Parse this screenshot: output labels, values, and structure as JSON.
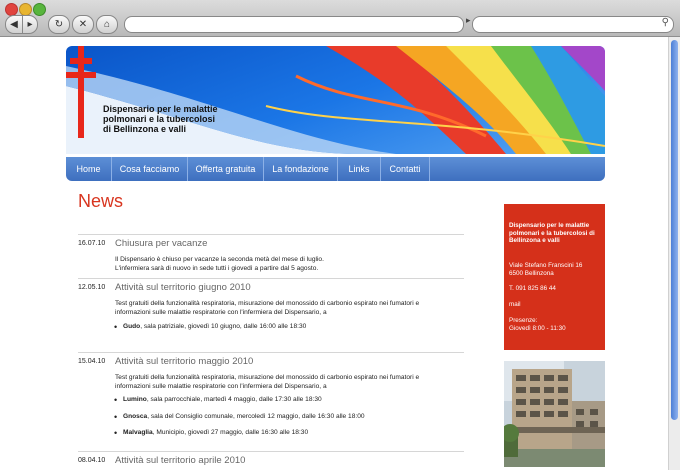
{
  "site": {
    "title": "Dispensario per le malattie\npolmonari e la tubercolosi\ndi Bellinzona e valli"
  },
  "nav": [
    "Home",
    "Cosa facciamo",
    "Offerta gratuita",
    "La fondazione",
    "Links",
    "Contatti"
  ],
  "page_heading": "News",
  "posts": [
    {
      "date": "16.07.10",
      "title": "Chiusura per vacanze",
      "text1": "Il Dispensario è chiuso per vacanze la seconda metà del mese di luglio.",
      "text2": "L'infermiera sarà di nuovo in sede tutti i giovedì a partire dal 5 agosto."
    },
    {
      "date": "12.05.10",
      "title": "Attività sul territorio giugno 2010",
      "text1": "Test gratuiti della funzionalità respiratoria, misurazione del monossido di carbonio espirato nei fumatori e",
      "text2": "informazioni sulle malattie respiratorie con l'infermiera del Dispensario, a",
      "bullets": [
        {
          "place": "Gudo",
          "detail": ", sala patriziale, giovedì 10 giugno, dalle 16:00 alle 18:30"
        }
      ]
    },
    {
      "date": "15.04.10",
      "title": "Attività sul territorio maggio 2010",
      "text1": "Test gratuiti della funzionalità respiratoria, misurazione del monossido di carbonio espirato nei fumatori e",
      "text2": "informazioni sulle malattie respiratorie con l'infermiera del Dispensario, a",
      "bullets": [
        {
          "place": "Lumino",
          "detail": ", sala parrocchiale, martedì 4 maggio, dalle 17:30 alle 18:30"
        },
        {
          "place": "Gnosca",
          "detail": ", sala del Consiglio comunale, mercoledì 12 maggio, dalle 16:30 alle 18:00"
        },
        {
          "place": "Malvaglia",
          "detail": ", Municipio, giovedì 27 maggio, dalle 16:30 alle 18:30"
        }
      ]
    },
    {
      "date": "08.04.10",
      "title": "Attività sul territorio aprile 2010"
    }
  ],
  "sidebar": {
    "name": "Dispensario per le malattie polmonari e la tubercolosi di Bellinzona e valli",
    "address1": "Viale Stefano Franscini 16",
    "address2": "6500 Bellinzona",
    "phone": "T. 091 825 86 44",
    "mail": "mail",
    "presence_label": "Presenze:",
    "presence_value": "Giovedì  8:00 - 11:30"
  },
  "icons": {
    "back": "◀",
    "forward": "▸",
    "reload": "↻",
    "stop": "✕",
    "home": "⌂",
    "search": "⚲",
    "url_arrow": "▸",
    "bullet": "•"
  },
  "colors": {
    "accent_red": "#d5301a",
    "nav_blue": "#4a7cc9",
    "heading_red": "#d8351f"
  }
}
